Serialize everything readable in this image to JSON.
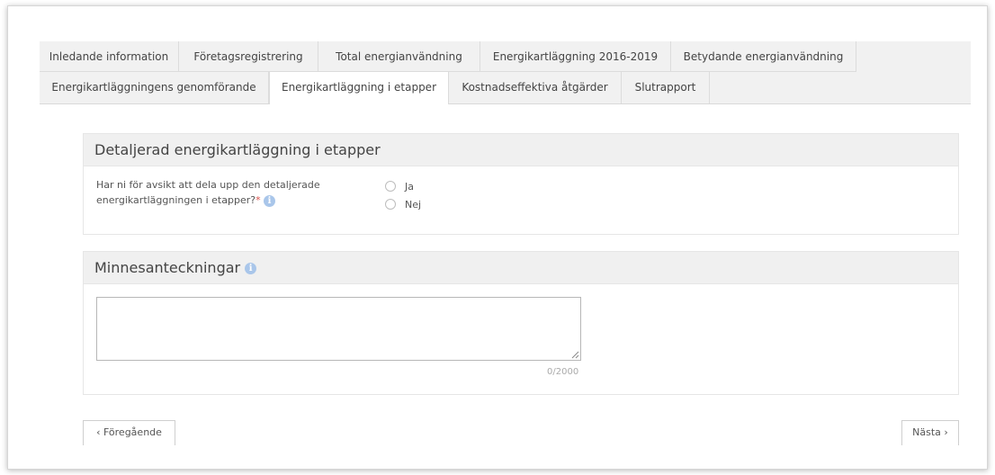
{
  "tabs": {
    "row1": [
      {
        "label": "Inledande information"
      },
      {
        "label": "Företagsregistrering"
      },
      {
        "label": "Total energianvändning"
      },
      {
        "label": "Energikartläggning 2016-2019"
      },
      {
        "label": "Betydande energianvändning"
      }
    ],
    "row2": [
      {
        "label": "Energikartläggningens genomförande"
      },
      {
        "label": "Energikartläggning i etapper"
      },
      {
        "label": "Kostnadseffektiva åtgärder"
      },
      {
        "label": "Slutrapport"
      }
    ],
    "active": "Energikartläggning i etapper"
  },
  "section1": {
    "title": "Detaljerad energikartläggning i etapper",
    "question": "Har ni för avsikt att dela upp den detaljerade energikartläggningen i etapper?",
    "required_mark": "*",
    "info_icon": "info-icon",
    "options": [
      {
        "label": "Ja",
        "selected": false
      },
      {
        "label": "Nej",
        "selected": false
      }
    ]
  },
  "section2": {
    "title": "Minnesanteckningar",
    "info_icon": "info-icon",
    "textarea_value": "",
    "counter": "0/2000"
  },
  "nav": {
    "prev_label": "Föregående",
    "next_label": "Nästa",
    "prev_icon": "chevron-left-icon",
    "next_icon": "chevron-right-icon"
  },
  "colors": {
    "tab_bg": "#f1f1f1",
    "active_tab_bg": "#ffffff",
    "panel_header_bg": "#f0f0f0",
    "info_icon": "#a9c6ea",
    "required": "#d9534f"
  }
}
